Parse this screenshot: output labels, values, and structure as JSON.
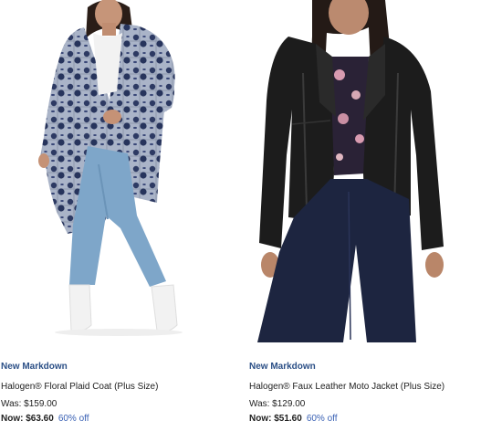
{
  "products": [
    {
      "badge": "New Markdown",
      "name": "Halogen® Floral Plaid Coat (Plus Size)",
      "was": "Was: $159.00",
      "now": "Now: $63.60",
      "discount": "60% off"
    },
    {
      "badge": "New Markdown",
      "name": "Halogen® Faux Leather Moto Jacket (Plus Size)",
      "was": "Was: $129.00",
      "now": "Now: $51.60",
      "discount": "60% off"
    }
  ],
  "colors": {
    "badge": "#2b4f86",
    "discount": "#3b62b5",
    "text": "#222222",
    "background": "#ffffff"
  }
}
